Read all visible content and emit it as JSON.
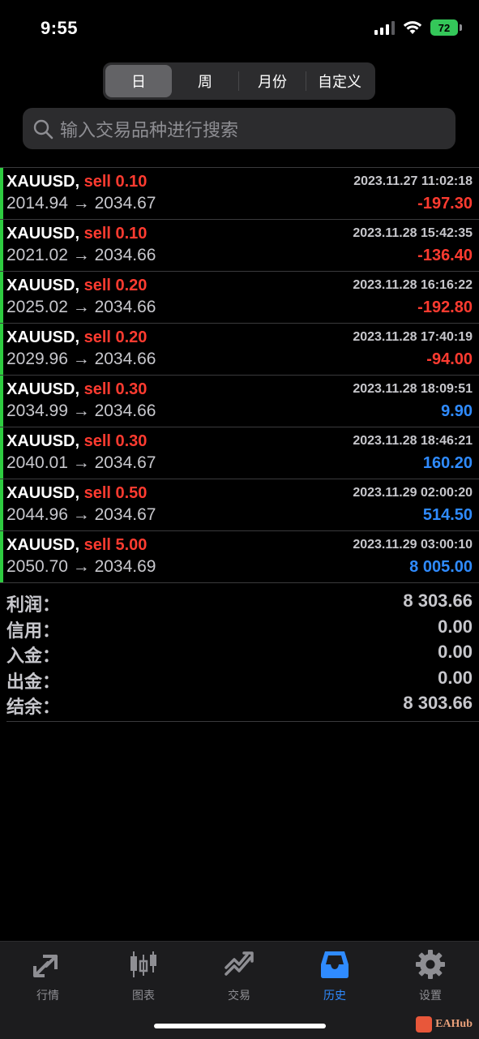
{
  "status_bar": {
    "time": "9:55",
    "battery": "72"
  },
  "period_tabs": [
    "日",
    "周",
    "月份",
    "自定义"
  ],
  "active_period": 0,
  "search": {
    "placeholder": "输入交易品种进行搜索"
  },
  "deals": [
    {
      "symbol": "XAUUSD,",
      "side": "sell 0.10",
      "prices": "2014.94 → 2034.67",
      "time": "2023.11.27 11:02:18",
      "profit": "-197.30",
      "profit_sign": "neg"
    },
    {
      "symbol": "XAUUSD,",
      "side": "sell 0.10",
      "prices": "2021.02 → 2034.66",
      "time": "2023.11.28 15:42:35",
      "profit": "-136.40",
      "profit_sign": "neg"
    },
    {
      "symbol": "XAUUSD,",
      "side": "sell 0.20",
      "prices": "2025.02 → 2034.66",
      "time": "2023.11.28 16:16:22",
      "profit": "-192.80",
      "profit_sign": "neg"
    },
    {
      "symbol": "XAUUSD,",
      "side": "sell 0.20",
      "prices": "2029.96 → 2034.66",
      "time": "2023.11.28 17:40:19",
      "profit": "-94.00",
      "profit_sign": "neg"
    },
    {
      "symbol": "XAUUSD,",
      "side": "sell 0.30",
      "prices": "2034.99 → 2034.66",
      "time": "2023.11.28 18:09:51",
      "profit": "9.90",
      "profit_sign": "pos"
    },
    {
      "symbol": "XAUUSD,",
      "side": "sell 0.30",
      "prices": "2040.01 → 2034.67",
      "time": "2023.11.28 18:46:21",
      "profit": "160.20",
      "profit_sign": "pos"
    },
    {
      "symbol": "XAUUSD,",
      "side": "sell 0.50",
      "prices": "2044.96 → 2034.67",
      "time": "2023.11.29 02:00:20",
      "profit": "514.50",
      "profit_sign": "pos"
    },
    {
      "symbol": "XAUUSD,",
      "side": "sell 5.00",
      "prices": "2050.70 → 2034.69",
      "time": "2023.11.29 03:00:10",
      "profit": "8 005.00",
      "profit_sign": "pos"
    }
  ],
  "summary": [
    {
      "label": "利润：",
      "value": "8 303.66"
    },
    {
      "label": "信用：",
      "value": "0.00"
    },
    {
      "label": "入金：",
      "value": "0.00"
    },
    {
      "label": "出金：",
      "value": "0.00"
    },
    {
      "label": "结余：",
      "value": "8 303.66"
    }
  ],
  "tabbar": [
    {
      "label": "行情",
      "icon": "quotes-arrows-icon"
    },
    {
      "label": "图表",
      "icon": "candlestick-chart-icon"
    },
    {
      "label": "交易",
      "icon": "trade-trend-icon"
    },
    {
      "label": "历史",
      "icon": "history-inbox-icon"
    },
    {
      "label": "设置",
      "icon": "gear-icon"
    }
  ],
  "active_tab": 3,
  "watermark": {
    "text": "EAHub"
  },
  "colors": {
    "loss": "#ff3b30",
    "gain": "#2f8bff",
    "side": "#ff3b30",
    "deal_marker": "#2ecc40",
    "active_tab": "#2f8bff",
    "battery": "#34c759"
  }
}
